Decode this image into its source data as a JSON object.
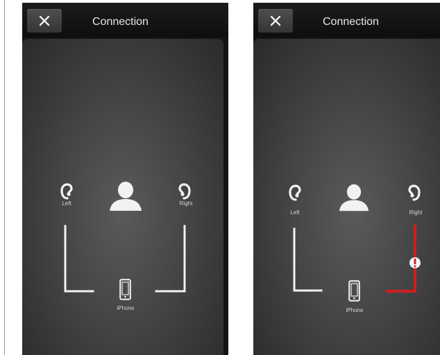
{
  "screens": [
    {
      "title": "Connection",
      "labels": {
        "left": "Left",
        "right": "Right",
        "phone": "iPhone"
      },
      "status": {
        "left": "connected",
        "right": "connected"
      }
    },
    {
      "title": "Connection",
      "labels": {
        "left": "Left",
        "right": "Right",
        "phone": "iPhone"
      },
      "status": {
        "left": "connected",
        "right": "error"
      }
    }
  ],
  "icons": {
    "close": "close-icon",
    "left_aid": "left-hearing-aid-icon",
    "right_aid": "right-hearing-aid-icon",
    "user": "user-icon",
    "phone": "phone-icon",
    "warning": "warning-icon"
  },
  "colors": {
    "line_ok": "#f2f2f2",
    "line_error": "#d21d1d",
    "background": "#141414",
    "panel": "#454545"
  }
}
